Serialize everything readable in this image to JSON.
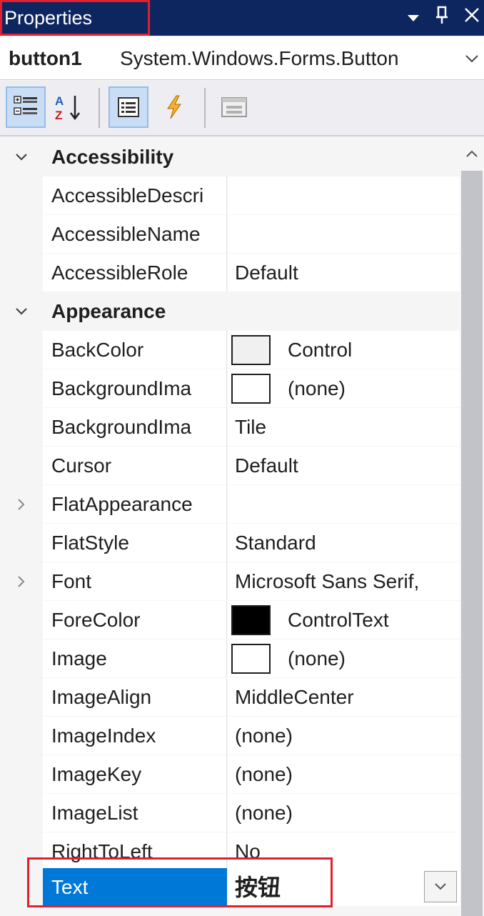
{
  "panel": {
    "title": "Properties",
    "pin_glyph": "1"
  },
  "selector": {
    "object_name": "button1",
    "object_type": "System.Windows.Forms.Button"
  },
  "toolbar": {
    "categorized": "categorized-icon",
    "alphabetical": "alphabetical-sort-icon",
    "properties": "properties-icon",
    "events": "events-lightning-icon",
    "property_pages": "property-pages-icon"
  },
  "grid": {
    "categories": [
      {
        "name": "Accessibility",
        "expanded": true,
        "properties": [
          {
            "name": "AccessibleDescri",
            "value": ""
          },
          {
            "name": "AccessibleName",
            "value": ""
          },
          {
            "name": "AccessibleRole",
            "value": "Default"
          }
        ]
      },
      {
        "name": "Appearance",
        "expanded": true,
        "properties": [
          {
            "name": "BackColor",
            "value": "Control",
            "swatch": "#f0f0f0"
          },
          {
            "name": "BackgroundIma",
            "value": "(none)",
            "swatch": "#ffffff"
          },
          {
            "name": "BackgroundIma",
            "value": "Tile"
          },
          {
            "name": "Cursor",
            "value": "Default"
          },
          {
            "name": "FlatAppearance",
            "value": "",
            "expandable": true
          },
          {
            "name": "FlatStyle",
            "value": "Standard"
          },
          {
            "name": "Font",
            "value": "Microsoft Sans Serif,",
            "expandable": true
          },
          {
            "name": "ForeColor",
            "value": "ControlText",
            "swatch": "#000000"
          },
          {
            "name": "Image",
            "value": "(none)",
            "swatch": "#ffffff"
          },
          {
            "name": "ImageAlign",
            "value": "MiddleCenter"
          },
          {
            "name": "ImageIndex",
            "value": "(none)"
          },
          {
            "name": "ImageKey",
            "value": "(none)"
          },
          {
            "name": "ImageList",
            "value": "(none)"
          },
          {
            "name": "RightToLeft",
            "value": "No"
          },
          {
            "name": "Text",
            "value": "按钮",
            "selected": true
          }
        ]
      }
    ]
  },
  "colors": {
    "title_bg": "#0e2660",
    "selection": "#0078d7",
    "highlight_box": "#e0202e"
  }
}
